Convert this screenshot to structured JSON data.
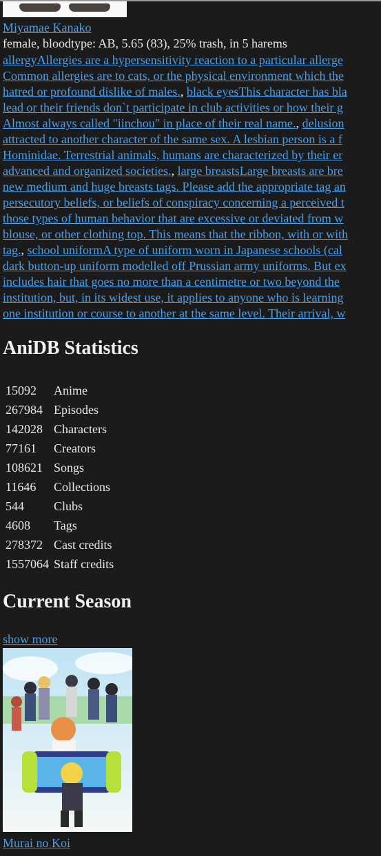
{
  "character": {
    "name": "Miyamae Kanako",
    "info": "female, bloodtype: AB, 5.65 (83), 25% trash, in 5 harems"
  },
  "tag_lines": [
    [
      {
        "t": "allergyAllergies are a hypersensitivity reaction to a particular allerge",
        "link": true
      }
    ],
    [
      {
        "t": "Common allergies are to cats, or the physical environment which the",
        "link": true
      }
    ],
    [
      {
        "t": "hatred or profound dislike of males.",
        "link": true
      },
      {
        "t": ", ",
        "link": false
      },
      {
        "t": "black eyesThis character has bla",
        "link": true
      }
    ],
    [
      {
        "t": "lead or their friends don`t participate in club activities or how their g",
        "link": true
      }
    ],
    [
      {
        "t": "Almost always called \"iinchou\" in place of their real name.",
        "link": true
      },
      {
        "t": ", ",
        "link": false
      },
      {
        "t": "delusion",
        "link": true
      }
    ],
    [
      {
        "t": "attracted to another character of the same sex. A lesbian person is a f",
        "link": true
      }
    ],
    [
      {
        "t": "Hominidae. Terrestrial animals, humans are characterized by their er",
        "link": true
      }
    ],
    [
      {
        "t": "advanced and organized societies.",
        "link": true
      },
      {
        "t": ", ",
        "link": false
      },
      {
        "t": "large breastsLarge breasts are bre",
        "link": true
      }
    ],
    [
      {
        "t": "new medium and huge breasts tags. Please add the appropriate tag an",
        "link": true
      }
    ],
    [
      {
        "t": "persecutory beliefs, or beliefs of conspiracy concerning a perceived t",
        "link": true
      }
    ],
    [
      {
        "t": "those types of human behavior that are excessive or deviated from w",
        "link": true
      }
    ],
    [
      {
        "t": "blouse, or other clothing top. This means that the ribbon, with or with",
        "link": true
      }
    ],
    [
      {
        "t": "tag.",
        "link": true
      },
      {
        "t": ", ",
        "link": false
      },
      {
        "t": "school uniformA type of uniform worn in Japanese schools (cal",
        "link": true
      }
    ],
    [
      {
        "t": "dark button-up uniform modelled off Prussian army uniforms. But ex",
        "link": true
      }
    ],
    [
      {
        "t": "includes hair that goes no more than a centimetre or two beyond the",
        "link": true
      }
    ],
    [
      {
        "t": "institution, but, in its widest use, it applies to anyone who is learning",
        "link": true
      }
    ],
    [
      {
        "t": "one institution or course to another at the same level. Their arrival, w",
        "link": true
      }
    ]
  ],
  "stats": {
    "heading": "AniDB Statistics",
    "rows": [
      {
        "value": "15092",
        "label": "Anime"
      },
      {
        "value": "267984",
        "label": "Episodes"
      },
      {
        "value": "142028",
        "label": "Characters"
      },
      {
        "value": "77161",
        "label": "Creators"
      },
      {
        "value": "108621",
        "label": "Songs"
      },
      {
        "value": "11646",
        "label": "Collections"
      },
      {
        "value": "544",
        "label": "Clubs"
      },
      {
        "value": "4608",
        "label": "Tags"
      },
      {
        "value": "278372",
        "label": "Cast credits"
      },
      {
        "value": "1557064",
        "label": "Staff credits"
      }
    ]
  },
  "season": {
    "heading": "Current Season",
    "show_more": "show more",
    "anime_title": "Murai no Koi"
  }
}
